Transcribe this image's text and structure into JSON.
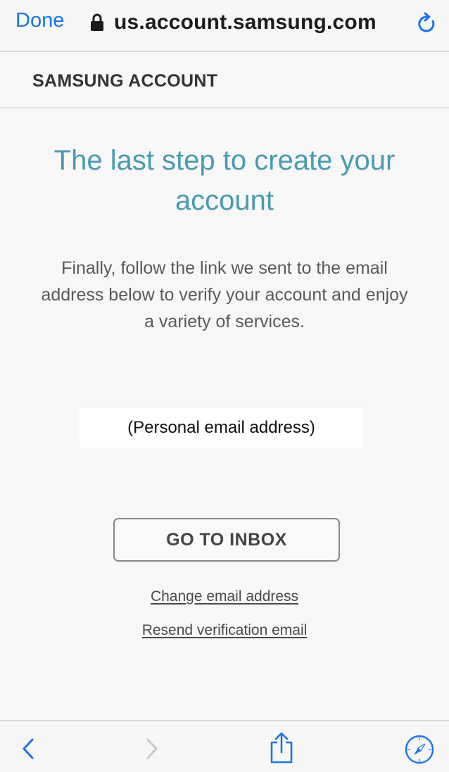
{
  "browser": {
    "done_label": "Done",
    "url": "us.account.samsung.com"
  },
  "site": {
    "title": "SAMSUNG ACCOUNT"
  },
  "main": {
    "headline": "The last step to create your account",
    "description": "Finally, follow the link we sent to the email address below to verify your account and enjoy a variety of services.",
    "email": "(Personal email address)",
    "go_to_inbox_label": "GO TO INBOX",
    "change_email_label": "Change email address",
    "resend_label": "Resend verification email"
  },
  "toolbar": {
    "icons": [
      "back-icon",
      "forward-icon",
      "share-icon",
      "compass-icon"
    ]
  },
  "colors": {
    "link_blue": "#1a73e8",
    "headline_teal": "#4a9ab0"
  }
}
